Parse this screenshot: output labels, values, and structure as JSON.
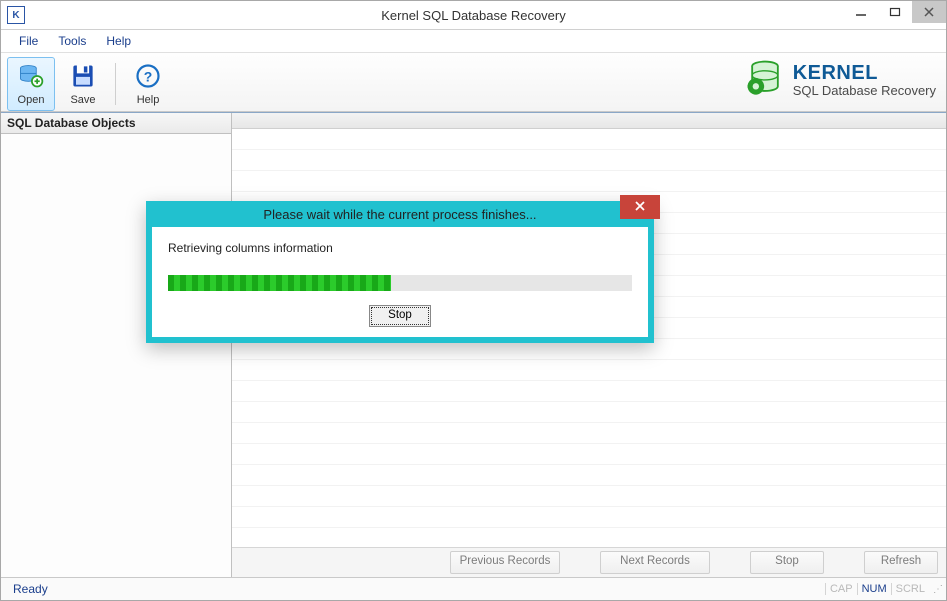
{
  "window": {
    "title": "Kernel SQL Database Recovery",
    "app_icon_letter": "K"
  },
  "menu": {
    "items": [
      "File",
      "Tools",
      "Help"
    ]
  },
  "toolbar": {
    "open_label": "Open",
    "save_label": "Save",
    "help_label": "Help"
  },
  "brand": {
    "title": "KERNEL",
    "subtitle": "SQL Database Recovery"
  },
  "sidebar": {
    "header": "SQL Database Objects"
  },
  "bottom_buttons": {
    "previous": "Previous Records",
    "next": "Next Records",
    "stop": "Stop",
    "refresh": "Refresh"
  },
  "statusbar": {
    "left": "Ready",
    "cap": "CAP",
    "num": "NUM",
    "scrl": "SCRL"
  },
  "dialog": {
    "title": "Please wait while the current process finishes...",
    "message": "Retrieving columns information",
    "stop": "Stop",
    "progress_percent": 48
  }
}
